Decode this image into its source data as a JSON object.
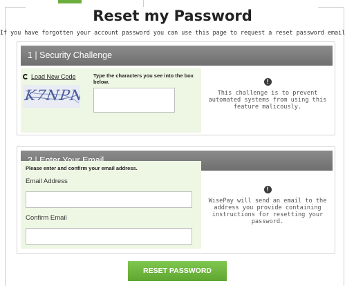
{
  "page": {
    "title": "Reset my Password",
    "intro": "If you have forgotten your account password you can use this page to request a reset password email."
  },
  "security": {
    "header": "1 | Security Challenge",
    "reload_label": "Load New Code",
    "captcha_text": "K7NPN",
    "type_hint": "Type the characters you see into the box below.",
    "captcha_value": "",
    "info_text": "This challenge is to prevent automated systems from using this feature malicously."
  },
  "email": {
    "header": "2 | Enter Your Email",
    "hint": "Please enter and confirm your email address.",
    "email_label": "Email Address",
    "email_value": "",
    "confirm_label": "Confirm Email",
    "confirm_value": "",
    "info_text": "WisePay will send an email to the address you provide containing instructions for resetting your password."
  },
  "actions": {
    "reset_label": "RESET PASSWORD"
  },
  "icons": {
    "info": "info-icon",
    "reload": "reload-icon"
  },
  "colors": {
    "accent": "#6cae3e",
    "panel_header": "#7a7a7a",
    "green_box": "#eef6e4"
  }
}
